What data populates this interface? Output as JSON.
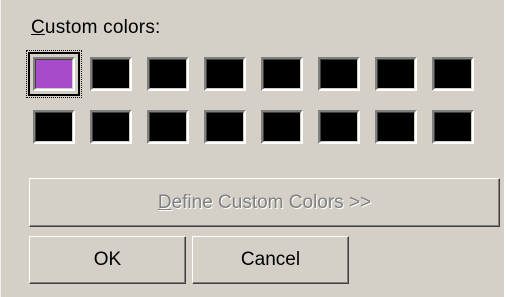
{
  "custom_colors": {
    "label": "Custom colors:",
    "label_mnemonic": "C",
    "label_rest": "ustom colors:",
    "swatches": [
      {
        "color": "#a84bc8",
        "selected": true
      },
      {
        "color": "#000000"
      },
      {
        "color": "#000000"
      },
      {
        "color": "#000000"
      },
      {
        "color": "#000000"
      },
      {
        "color": "#000000"
      },
      {
        "color": "#000000"
      },
      {
        "color": "#000000"
      },
      {
        "color": "#000000"
      },
      {
        "color": "#000000"
      },
      {
        "color": "#000000"
      },
      {
        "color": "#000000"
      },
      {
        "color": "#000000"
      },
      {
        "color": "#000000"
      },
      {
        "color": "#000000"
      },
      {
        "color": "#000000"
      }
    ]
  },
  "define_button": {
    "label": "Define Custom Colors >>",
    "label_mnemonic": "D",
    "label_rest": "efine Custom Colors >>",
    "enabled": false
  },
  "ok_button": {
    "label": "OK"
  },
  "cancel_button": {
    "label": "Cancel"
  },
  "colors": {
    "dialog_bg": "#d4d0c8",
    "selected_custom_color": "#a84bc8"
  }
}
